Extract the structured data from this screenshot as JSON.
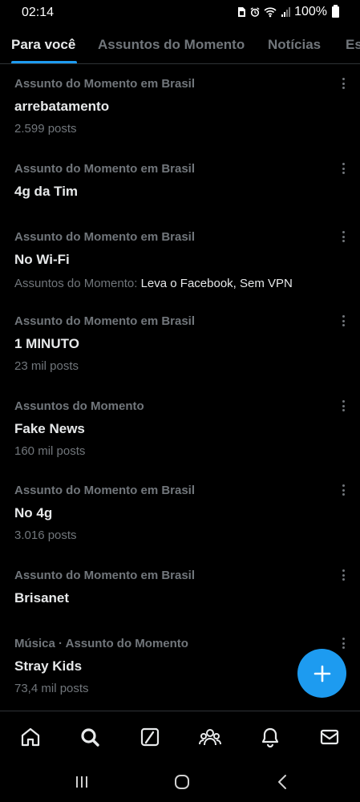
{
  "status_bar": {
    "time": "02:14",
    "battery": "100%",
    "icons": [
      "sim-icon",
      "alarm-icon",
      "wifi-icon",
      "signal-icon",
      "battery-icon"
    ]
  },
  "tabs": [
    {
      "label": "Para você",
      "active": true
    },
    {
      "label": "Assuntos do Momento",
      "active": false
    },
    {
      "label": "Notícias",
      "active": false
    },
    {
      "label": "Esportes",
      "active": false
    }
  ],
  "trends": [
    {
      "context": "Assunto do Momento em Brasil",
      "title": "arrebatamento",
      "meta": "2.599 posts"
    },
    {
      "context": "Assunto do Momento em Brasil",
      "title": "4g da Tim",
      "meta": ""
    },
    {
      "context": "Assunto do Momento em Brasil",
      "title": "No Wi-Fi",
      "meta_prefix": "Assuntos do Momento: ",
      "meta_related": "Leva o Facebook, Sem VPN"
    },
    {
      "context": "Assunto do Momento em Brasil",
      "title": "1 MINUTO",
      "meta": "23 mil posts"
    },
    {
      "context": "Assuntos do Momento",
      "title": "Fake News",
      "meta": "160 mil posts"
    },
    {
      "context": "Assunto do Momento em Brasil",
      "title": "No 4g",
      "meta": "3.016 posts"
    },
    {
      "context": "Assunto do Momento em Brasil",
      "title": "Brisanet",
      "meta": ""
    },
    {
      "context": "Música · Assunto do Momento",
      "title": "Stray Kids",
      "meta": "73,4 mil posts"
    }
  ],
  "fab": {
    "icon": "plus-icon"
  },
  "bottom_nav": [
    "home-icon",
    "search-icon",
    "grok-icon",
    "communities-icon",
    "notifications-icon",
    "messages-icon"
  ],
  "system_nav": [
    "recents-icon",
    "home-circle-icon",
    "back-icon"
  ],
  "colors": {
    "accent": "#1d9bf0",
    "background": "#000000",
    "text_primary": "#e7e9ea",
    "text_secondary": "#71767b",
    "divider": "#2f3336"
  }
}
